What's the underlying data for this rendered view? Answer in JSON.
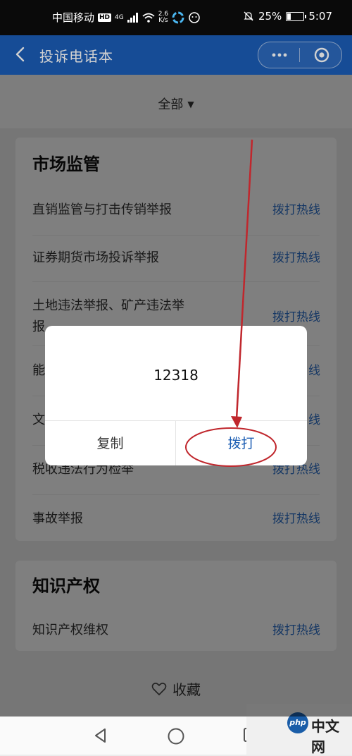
{
  "status_bar": {
    "carrier": "中国移动",
    "hd": "HD",
    "network": "4G",
    "speed_value": "2.6",
    "speed_unit": "K/s",
    "battery": "25%",
    "battery_level": 0.25,
    "time": "5:07"
  },
  "title_bar": {
    "title": "投诉电话本"
  },
  "filter": {
    "label": "全部"
  },
  "sections": [
    {
      "title": "市场监管",
      "items": [
        {
          "label": "直销监管与打击传销举报",
          "action": "拨打热线"
        },
        {
          "label": "证券期货市场投诉举报",
          "action": "拨打热线"
        },
        {
          "label_line1": "土地违法举报、矿产违法举",
          "label_line2": "报",
          "action": "拨打热线"
        },
        {
          "label": "能",
          "action": "线"
        },
        {
          "label": "文",
          "action": "线"
        },
        {
          "label": "税收违法行为检举",
          "action": "拨打热线"
        },
        {
          "label": "事故举报",
          "action": "拨打热线"
        }
      ]
    },
    {
      "title": "知识产权",
      "items": [
        {
          "label": "知识产权维权",
          "action": "拨打热线"
        }
      ]
    }
  ],
  "favorite": {
    "label": "收藏"
  },
  "dialog": {
    "number": "12318",
    "copy_label": "复制",
    "dial_label": "拨打"
  },
  "watermark": {
    "logo": "php",
    "text": "中文网"
  },
  "colors": {
    "title_bar": "#1b5db8",
    "link": "#2a6ec8",
    "annotation": "#c0272d"
  }
}
